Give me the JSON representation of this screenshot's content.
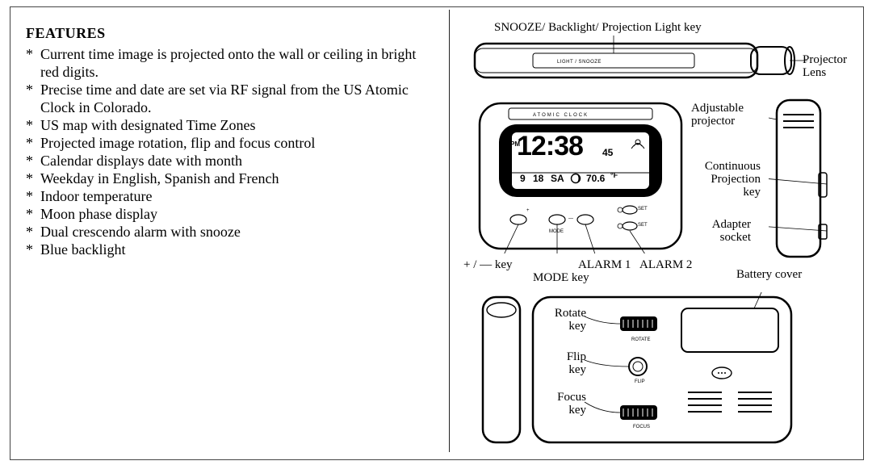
{
  "left": {
    "heading": "FEATURES",
    "items": [
      "Current time image is projected onto the wall or ceiling in bright red digits.",
      "Precise time and date are set via RF signal from the US Atomic Clock in Colorado.",
      "US map with designated Time Zones",
      "Projected image rotation, flip and focus control",
      "Calendar displays date with month",
      "Weekday in English, Spanish and French",
      "Indoor temperature",
      "Moon phase display",
      "Dual crescendo alarm with snooze",
      "Blue backlight"
    ]
  },
  "diagrams": {
    "top_label": "SNOOZE/ Backlight/ Projection Light key",
    "top_button": "LIGHT / SNOOZE",
    "projector_lens": "Projector Lens",
    "adjustable_projector": "Adjustable projector",
    "continuous_projection_key": "Continuous Projection key",
    "adapter_socket": "Adapter socket",
    "plus_minus_key": "+ / — key",
    "mode_key": "MODE key",
    "alarm1": "ALARM 1",
    "alarm2": "ALARM 2",
    "battery_cover": "Battery cover",
    "rotate_key": "Rotate key",
    "flip_key": "Flip key",
    "focus_key": "Focus key",
    "lcd_brand": "ATOMIC  CLOCK",
    "lcd_time_pm": "PM",
    "lcd_time": "12:38",
    "lcd_time_sec": "45",
    "lcd_month": "9",
    "lcd_day": "18",
    "lcd_weekday": "SA",
    "lcd_temp": "70.6",
    "lcd_temp_unit": "°F",
    "btn_plus": "+",
    "btn_minus": "—",
    "btn_mode": "MODE",
    "btn_set_top": "SET",
    "btn_set_bottom": "SET",
    "back_rotate": "ROTATE",
    "back_flip": "FLIP",
    "back_focus": "FOCUS"
  }
}
